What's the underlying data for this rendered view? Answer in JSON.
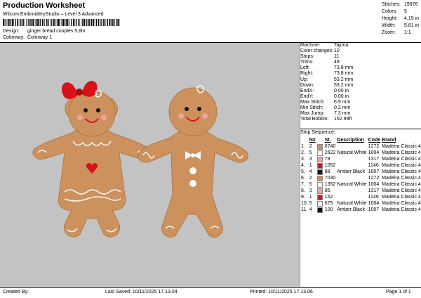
{
  "header": {
    "title": "Production Worksheet",
    "subtitle": "Wilcom EmbroideryStudio – Level 3 Advanced"
  },
  "meta": {
    "design_label": "Design:",
    "design_value": "ginger bread couples 5,8in",
    "colorway_label": "Colorway:",
    "colorway_value": "Colorway 1"
  },
  "stats": [
    {
      "label": "Stitches:",
      "value": "19976"
    },
    {
      "label": "Colors:",
      "value": "5"
    },
    {
      "label": "Height:",
      "value": "4.19 in"
    },
    {
      "label": "Width:",
      "value": "5.81 in"
    },
    {
      "label": "Zoom:",
      "value": "1:1"
    }
  ],
  "machine_info": [
    {
      "label": "Machine:",
      "value": "Tajima"
    },
    {
      "label": "Color changes:",
      "value": "10"
    },
    {
      "label": "Stops:",
      "value": "11"
    },
    {
      "label": "Trims:",
      "value": "49"
    },
    {
      "label": "Left:",
      "value": "73.8 mm"
    },
    {
      "label": "Right:",
      "value": "73.8 mm"
    },
    {
      "label": "Up:",
      "value": "53.2 mm"
    },
    {
      "label": "Down:",
      "value": "53.2 mm"
    },
    {
      "label": "EndX:",
      "value": "0.00 in"
    },
    {
      "label": "EndY:",
      "value": "0.00 in"
    },
    {
      "label": "Max Stitch:",
      "value": "6.9 mm"
    },
    {
      "label": "Min Stitch:",
      "value": "0.2 mm"
    },
    {
      "label": "Max Jump:",
      "value": "7.3 mm"
    },
    {
      "label": "Total Bobbin:",
      "value": "152.99ft"
    }
  ],
  "stop_sequence": {
    "title": "Stop Sequence:",
    "headers": [
      "",
      "N#",
      "St.",
      "Description",
      "Code",
      "Brand"
    ],
    "rows": [
      {
        "stop": "1.",
        "n": "2",
        "color": "#c89060",
        "st": "6740",
        "desc": "",
        "code": "1272",
        "brand": "Madeira Classic 40"
      },
      {
        "stop": "2.",
        "n": "5",
        "color": "#f4f4f4",
        "st": "2622",
        "desc": "Natural White",
        "code": "1004",
        "brand": "Madeira Classic 40"
      },
      {
        "stop": "3.",
        "n": "3",
        "color": "#f0a39a",
        "st": "78",
        "desc": "",
        "code": "1317",
        "brand": "Madeira Classic 40"
      },
      {
        "stop": "4.",
        "n": "1",
        "color": "#d8121a",
        "st": "1052",
        "desc": "",
        "code": "1146",
        "brand": "Madeira Classic 40"
      },
      {
        "stop": "5.",
        "n": "4",
        "color": "#101010",
        "st": "88",
        "desc": "Amber Black",
        "code": "1007",
        "brand": "Madeira Classic 40"
      },
      {
        "stop": "6.",
        "n": "2",
        "color": "#c89060",
        "st": "7030",
        "desc": "",
        "code": "1272",
        "brand": "Madeira Classic 40"
      },
      {
        "stop": "7.",
        "n": "5",
        "color": "#f4f4f4",
        "st": "1352",
        "desc": "Natural White",
        "code": "1004",
        "brand": "Madeira Classic 40"
      },
      {
        "stop": "8.",
        "n": "3",
        "color": "#f0a39a",
        "st": "85",
        "desc": "",
        "code": "1317",
        "brand": "Madeira Classic 40"
      },
      {
        "stop": "9.",
        "n": "1",
        "color": "#d8121a",
        "st": "152",
        "desc": "",
        "code": "1146",
        "brand": "Madeira Classic 40"
      },
      {
        "stop": "10.",
        "n": "5",
        "color": "#f4f4f4",
        "st": "675",
        "desc": "Natural White",
        "code": "1004",
        "brand": "Madeira Classic 40"
      },
      {
        "stop": "11.",
        "n": "4",
        "color": "#101010",
        "st": "100",
        "desc": "Amber Black",
        "code": "1007",
        "brand": "Madeira Classic 40"
      }
    ]
  },
  "footer": {
    "created_by": "Created By:",
    "last_saved": "Last Saved: 10/11/2025 17.13.04",
    "printed": "Printed: 10/11/2025 17.13.06",
    "page": "Page 1 of 1"
  },
  "colors": {
    "canvas": "#c3c3c3",
    "cookie": "#cf9460",
    "cookie_dark": "#b47a48",
    "bow": "#d8121a",
    "cheek": "#f0a39a",
    "icing": "#f8f8f8"
  }
}
